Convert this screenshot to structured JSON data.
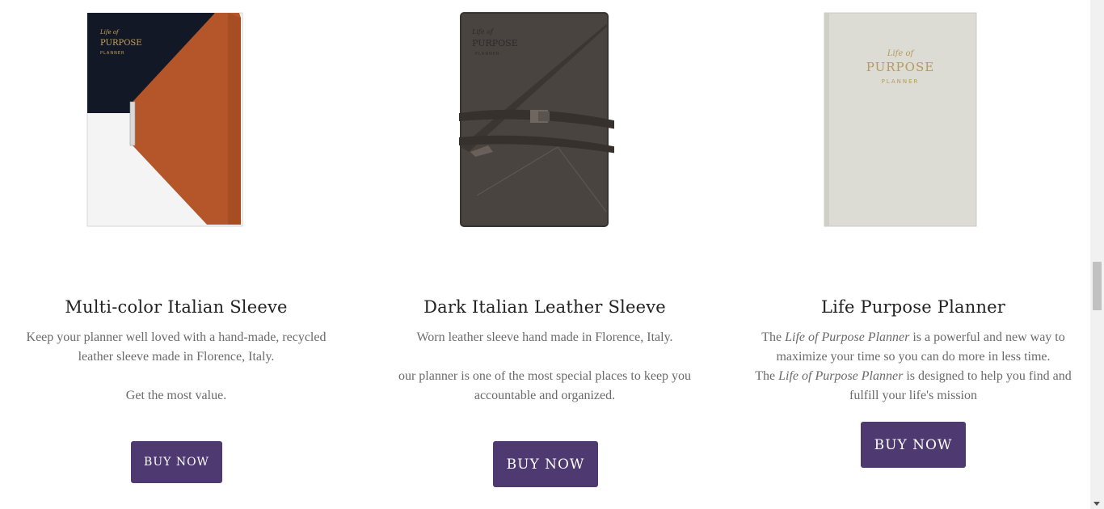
{
  "products": [
    {
      "title": "Multi-color Italian  Sleeve",
      "image_alt": "Multi-color leather planner sleeve",
      "cover_text": [
        "Life of",
        "PURPOSE",
        "PLANNER"
      ],
      "desc": [
        "Keep your planner well loved with a hand-made, recycled leather sleeve made in Florence, Italy.",
        "Get the most value."
      ],
      "button": "BUY NOW"
    },
    {
      "title": "Dark Italian Leather Sleeve",
      "image_alt": "Dark Italian leather planner sleeve",
      "cover_text": [
        "Life of",
        "PURPOSE",
        "PLANNER"
      ],
      "desc": [
        "Worn leather sleeve hand made in  Florence, Italy.",
        "our planner is one of the most special places to keep you accountable and organized."
      ],
      "button": "BUY NOW"
    },
    {
      "title": "Life Purpose Planner",
      "image_alt": "Life of Purpose Planner",
      "cover_text": [
        "Life of",
        "PURPOSE",
        "PLANNER"
      ],
      "desc_parts": {
        "p1_pre": "The ",
        "p1_em": "Life of Purpose Planner",
        "p1_post": " is  a powerful and new way to maximize your time so you can do more in less time.",
        "p2_pre": "The ",
        "p2_em": "Life  of Purpose Planner",
        "p2_post": " is designed to help you find and fulfill your life's mission"
      },
      "button": "BUY NOW"
    }
  ],
  "colors": {
    "button": "#4e3a70",
    "title": "#222222",
    "text": "#6a6a6a"
  }
}
